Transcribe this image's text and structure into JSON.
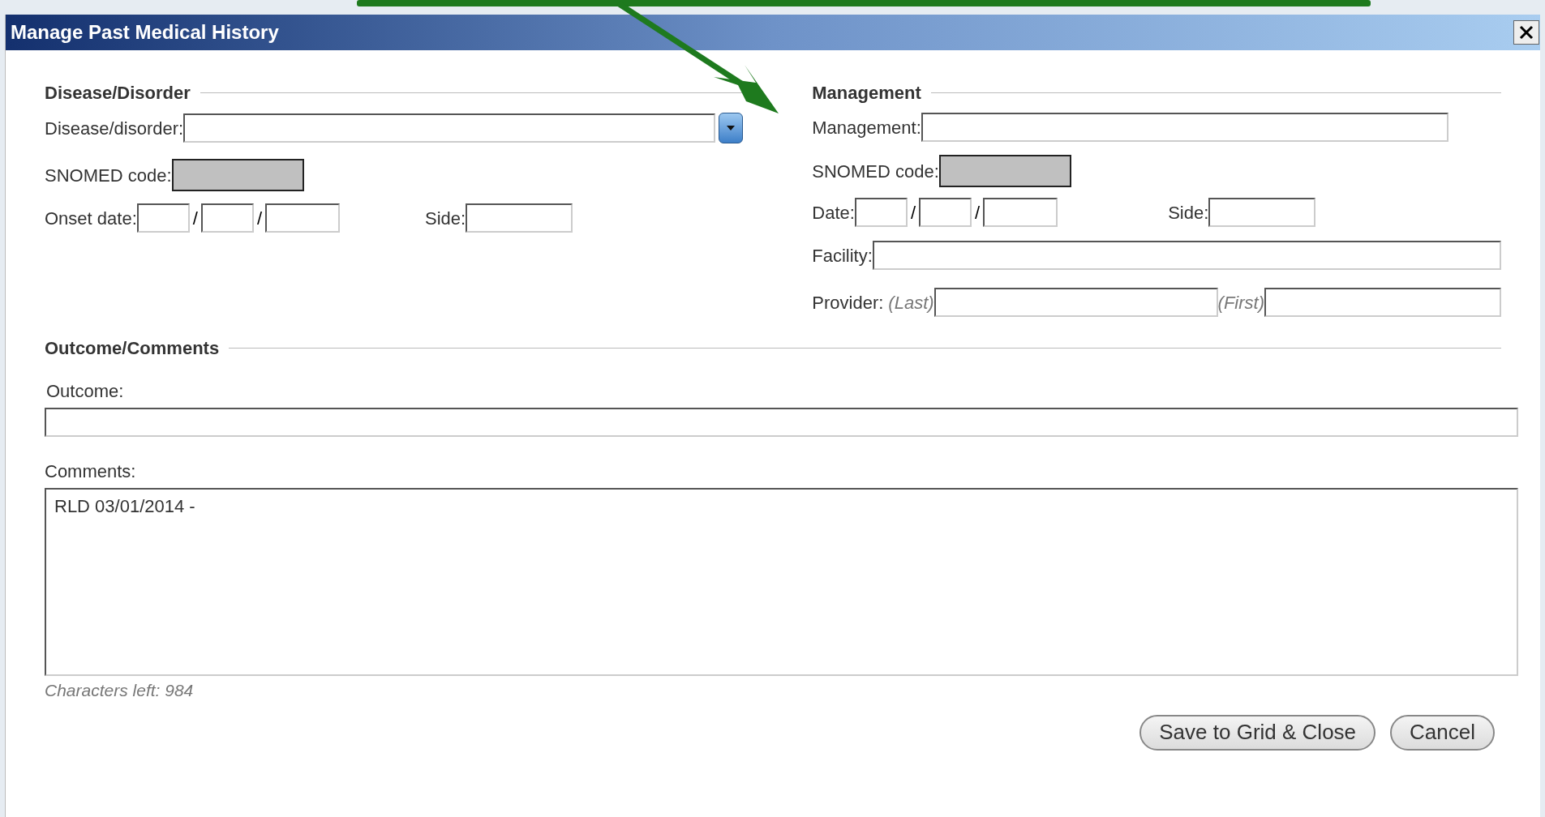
{
  "window": {
    "title": "Manage Past Medical History"
  },
  "disease": {
    "heading": "Disease/Disorder",
    "disorder_label": "Disease/disorder:",
    "snomed_label": "SNOMED code:",
    "onset_label": "Onset date:",
    "date_separators": [
      "/",
      "/"
    ],
    "side_label": "Side:"
  },
  "management": {
    "heading": "Management",
    "management_label": "Management:",
    "snomed_label": "SNOMED code:",
    "date_label": "Date:",
    "date_separators": [
      "/",
      "/"
    ],
    "side_label": "Side:",
    "facility_label": "Facility:",
    "provider_label": "Provider:",
    "last_hint": "(Last)",
    "first_hint": "(First)"
  },
  "outcome": {
    "heading": "Outcome/Comments",
    "outcome_label": "Outcome:",
    "comments_label": "Comments:",
    "comments_value": "RLD 03/01/2014 -",
    "chars_left": "Characters left: 984"
  },
  "buttons": [
    {
      "label": "Save to Grid & Close"
    },
    {
      "label": "Cancel"
    }
  ]
}
